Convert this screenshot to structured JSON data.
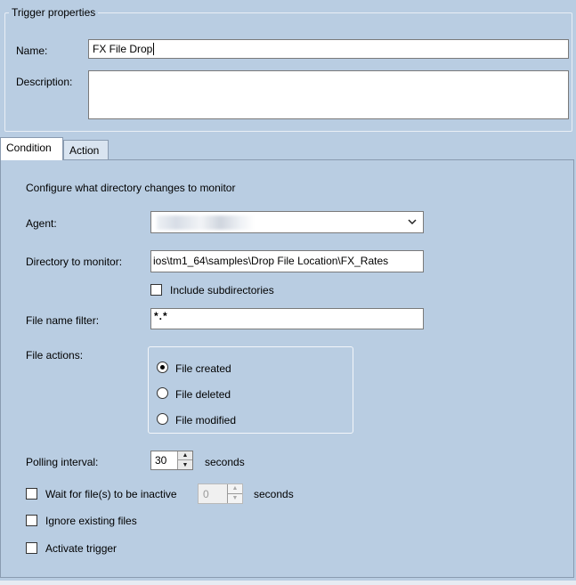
{
  "trigger_properties": {
    "legend": "Trigger properties",
    "name_label": "Name:",
    "name_value": "FX File Drop",
    "description_label": "Description:",
    "description_value": ""
  },
  "tabs": [
    {
      "label": "Condition",
      "active": true
    },
    {
      "label": "Action",
      "active": false
    }
  ],
  "condition": {
    "heading": "Configure what directory changes to monitor",
    "agent_label": "Agent:",
    "agent_value": "",
    "directory_label": "Directory to monitor:",
    "directory_value": "ios\\tm1_64\\samples\\Drop File Location\\FX_Rates",
    "include_subdirectories_label": "Include subdirectories",
    "include_subdirectories_checked": false,
    "file_name_filter_label": "File name filter:",
    "file_name_filter_value": "*.*",
    "file_actions_label": "File actions:",
    "file_actions": [
      {
        "label": "File created",
        "selected": true
      },
      {
        "label": "File deleted",
        "selected": false
      },
      {
        "label": "File modified",
        "selected": false
      }
    ],
    "polling_interval_label": "Polling interval:",
    "polling_interval_value": "30",
    "polling_interval_unit": "seconds",
    "wait_inactive_label": "Wait for file(s) to be inactive",
    "wait_inactive_checked": false,
    "wait_inactive_value": "0",
    "wait_inactive_unit": "seconds",
    "ignore_existing_label": "Ignore existing files",
    "ignore_existing_checked": false,
    "activate_trigger_label": "Activate trigger",
    "activate_trigger_checked": false
  },
  "icons": {
    "dropdown": "chevron-down-icon",
    "spin_up": "spin-up-icon",
    "spin_down": "spin-down-icon"
  }
}
